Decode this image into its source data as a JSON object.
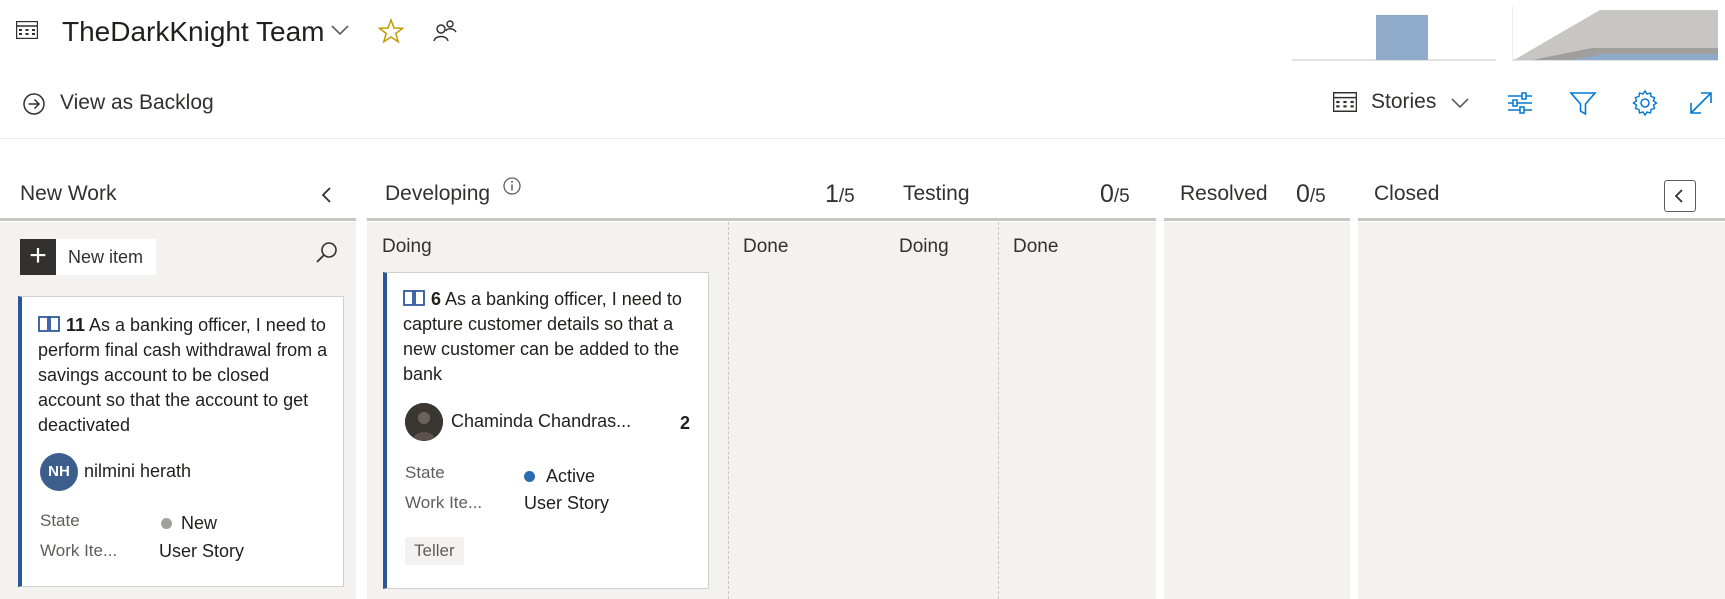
{
  "header": {
    "team_name": "TheDarkKnight Team",
    "view_backlog_label": "View as Backlog",
    "backlog_level_label": "Stories"
  },
  "columns": [
    {
      "title": "New Work"
    },
    {
      "title": "Developing",
      "count": "1",
      "limit": "/5",
      "sub_columns": [
        "Doing",
        "Done"
      ]
    },
    {
      "title": "Testing",
      "count": "0",
      "limit": "/5",
      "sub_columns": [
        "Doing",
        "Done"
      ]
    },
    {
      "title": "Resolved",
      "count": "0",
      "limit": "/5"
    },
    {
      "title": "Closed"
    }
  ],
  "new_item_label": "New item",
  "cards": [
    {
      "id": "11",
      "title": "As a banking officer, I need to perform final cash withdrawal from a savings account to be closed account so that the account to get deactivated",
      "avatar_initials": "NH",
      "assignee": "nilmini herath",
      "state_label": "State",
      "state_value": "New",
      "state_color": "#a19f9d",
      "type_label": "Work Ite...",
      "type_value": "User Story"
    },
    {
      "id": "6",
      "title": "As a banking officer, I need to capture customer details so that a new customer can be added to the bank",
      "assignee": "Chaminda Chandras...",
      "effort": "2",
      "state_label": "State",
      "state_value": "Active",
      "state_color": "#2b6cb0",
      "type_label": "Work Ite...",
      "type_value": "User Story",
      "tag": "Teller"
    }
  ],
  "colors": {
    "accent": "#2b579a",
    "column_bg": "#f3f2f1",
    "chart_bar": "#8fabc9"
  },
  "icons": [
    "board-icon",
    "chevron-down-icon",
    "star-icon",
    "people-icon",
    "arrow-circle-right-icon",
    "settings-sliders-icon",
    "filter-icon",
    "gear-icon",
    "expand-icon",
    "info-icon",
    "chevron-left-icon",
    "search-icon",
    "book-icon"
  ]
}
